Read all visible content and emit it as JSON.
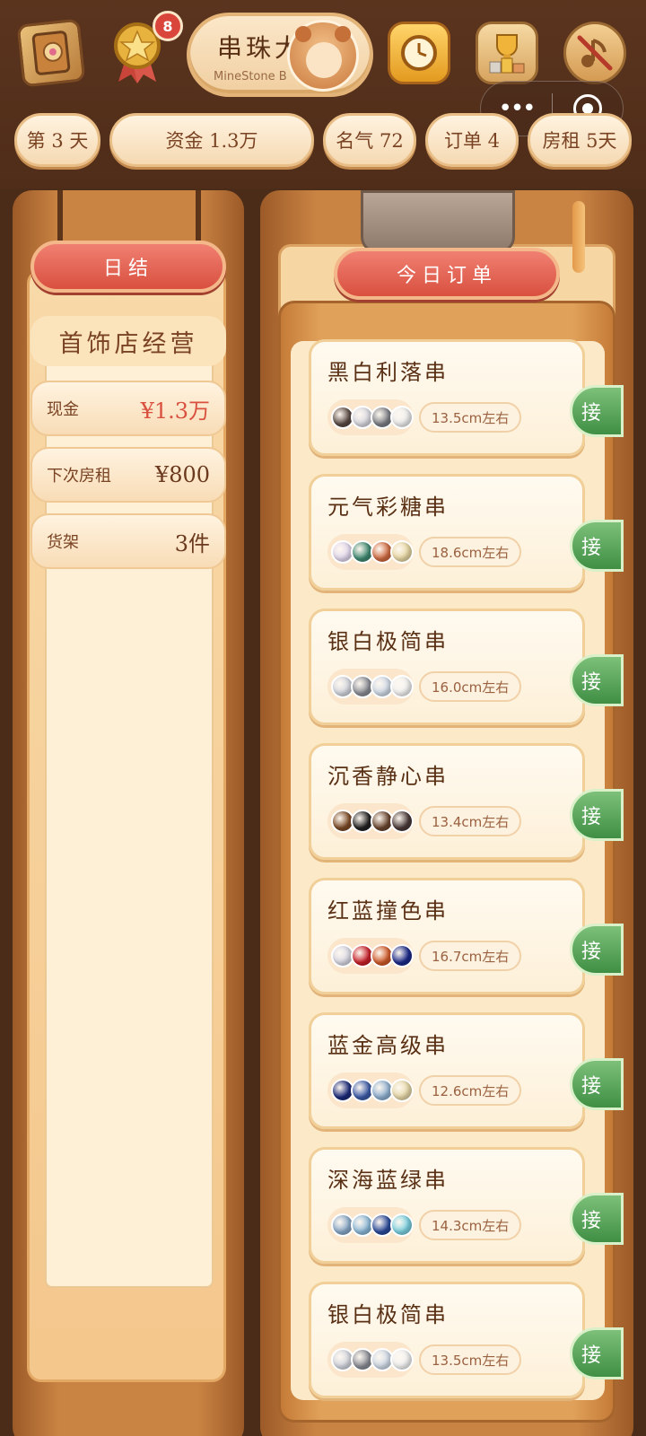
{
  "header": {
    "title": "串珠大",
    "subtitle": "MineStone B",
    "notification_count": "8",
    "icons": [
      "book-icon",
      "medal-icon",
      "clock-icon",
      "trophy-icon",
      "mute-icon"
    ]
  },
  "status": {
    "day": "第 3 天",
    "funds": "资金 1.3万",
    "reputation": "名气 72",
    "orders": "订单 4",
    "rent": "房租 5天"
  },
  "left_panel": {
    "button_label": "日结",
    "shop_title": "首饰店经营",
    "rows": [
      {
        "label": "现金",
        "value": "¥1.3万"
      },
      {
        "label": "下次房租",
        "value": "¥800"
      },
      {
        "label": "货架",
        "value": "3件"
      }
    ]
  },
  "right_panel": {
    "header": "今日订单",
    "accept_label": "接",
    "orders": [
      {
        "name": "黑白利落串",
        "size": "13.5cm左右",
        "beads": [
          "#5a4a44",
          "#d8d8e0",
          "#7d7f86",
          "#eeeeee"
        ]
      },
      {
        "name": "元气彩糖串",
        "size": "18.6cm左右",
        "beads": [
          "#e2d8ee",
          "#3f8a72",
          "#d06b42",
          "#e8d8a4"
        ]
      },
      {
        "name": "银白极简串",
        "size": "16.0cm左右",
        "beads": [
          "#d3d6de",
          "#8a8d95",
          "#cfd9e6",
          "#f2f2f2"
        ]
      },
      {
        "name": "沉香静心串",
        "size": "13.4cm左右",
        "beads": [
          "#7b4a26",
          "#222222",
          "#6a4630",
          "#4a3a38"
        ]
      },
      {
        "name": "红蓝撞色串",
        "size": "16.7cm左右",
        "beads": [
          "#d8d8e4",
          "#c8202a",
          "#cf5a2a",
          "#1b2a8a"
        ]
      },
      {
        "name": "蓝金高级串",
        "size": "12.6cm左右",
        "beads": [
          "#1b2a7a",
          "#3c5ba8",
          "#8fb0d0",
          "#e6d8a8"
        ]
      },
      {
        "name": "深海蓝绿串",
        "size": "14.3cm左右",
        "beads": [
          "#88a8c8",
          "#8cb8d8",
          "#2a4a9a",
          "#7ad0e0"
        ]
      },
      {
        "name": "银白极简串",
        "size": "13.5cm左右",
        "beads": [
          "#d3d6de",
          "#8a8d95",
          "#cfd9e6",
          "#f2f2f2"
        ]
      }
    ]
  }
}
